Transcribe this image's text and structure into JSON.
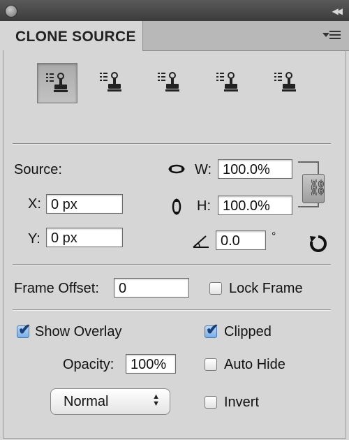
{
  "panel": {
    "title": "CLONE SOURCE"
  },
  "source_buttons": [
    {
      "name": "clone-source-1",
      "active": true
    },
    {
      "name": "clone-source-2",
      "active": false
    },
    {
      "name": "clone-source-3",
      "active": false
    },
    {
      "name": "clone-source-4",
      "active": false
    },
    {
      "name": "clone-source-5",
      "active": false
    }
  ],
  "source": {
    "label": "Source:",
    "x_label": "X:",
    "x_value": "0 px",
    "y_label": "Y:",
    "y_value": "0 px",
    "w_label": "W:",
    "w_value": "100.0%",
    "h_label": "H:",
    "h_value": "100.0%",
    "angle_value": "0.0",
    "angle_unit": "°"
  },
  "frame": {
    "offset_label": "Frame Offset:",
    "offset_value": "0",
    "lock_label": "Lock Frame",
    "lock_checked": false
  },
  "overlay": {
    "show_label": "Show Overlay",
    "show_checked": true,
    "opacity_label": "Opacity:",
    "opacity_value": "100%",
    "mode_value": "Normal",
    "clipped_label": "Clipped",
    "clipped_checked": true,
    "autohide_label": "Auto Hide",
    "autohide_checked": false,
    "invert_label": "Invert",
    "invert_checked": false
  },
  "icons": {
    "flip_horizontal": "flip-horizontal-icon",
    "flip_vertical": "flip-vertical-icon",
    "angle": "angle-icon",
    "reset": "reset-transform-icon",
    "link": "link-icon"
  }
}
